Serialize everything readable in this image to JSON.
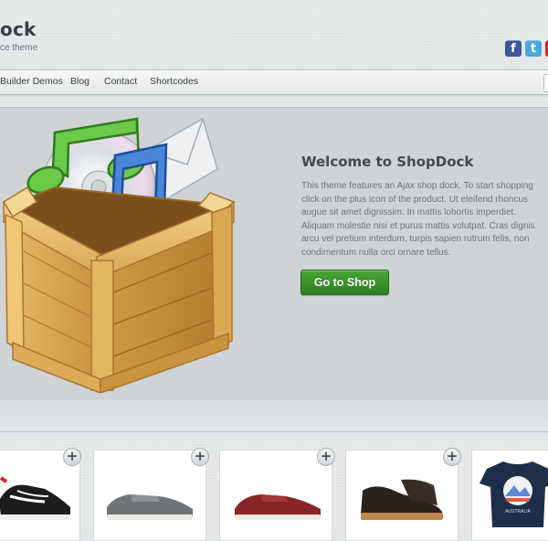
{
  "header": {
    "title": "ock",
    "tagline": "ce theme",
    "social": [
      {
        "name": "facebook",
        "glyph": "f"
      },
      {
        "name": "twitter",
        "glyph": "t"
      }
    ]
  },
  "nav": {
    "items": [
      "Builder Demos",
      "Blog",
      "Contact",
      "Shortcodes"
    ]
  },
  "hero": {
    "title": "Welcome to ShopDock",
    "lines": [
      "This theme features an Ajax shop dock. To start shopping",
      "click on the plus icon of the product. Ut eleifend rhoncus",
      "augue sit amet dignissim. In mattis lobortis imperdiet.",
      "Aliquam molestie nisi et purus mattis volutpat. Cras dignis",
      "arcu vel pretium interdum, turpis sapien rutrum felis, non",
      "condimentum nulla orci ornare tellus."
    ],
    "button_label": "Go to Shop"
  },
  "products": [
    {
      "name": "black-white-sneaker",
      "add_glyph": "+"
    },
    {
      "name": "grey-sneaker",
      "add_glyph": "+"
    },
    {
      "name": "red-sneaker",
      "add_glyph": "+"
    },
    {
      "name": "brown-boot",
      "add_glyph": "+"
    },
    {
      "name": "navy-tshirt",
      "add_glyph": "+",
      "print_text": "AUSTRALIA"
    }
  ],
  "colors": {
    "accent_green": "#3a9129",
    "facebook": "#3b5998",
    "twitter": "#4aa8dd"
  }
}
